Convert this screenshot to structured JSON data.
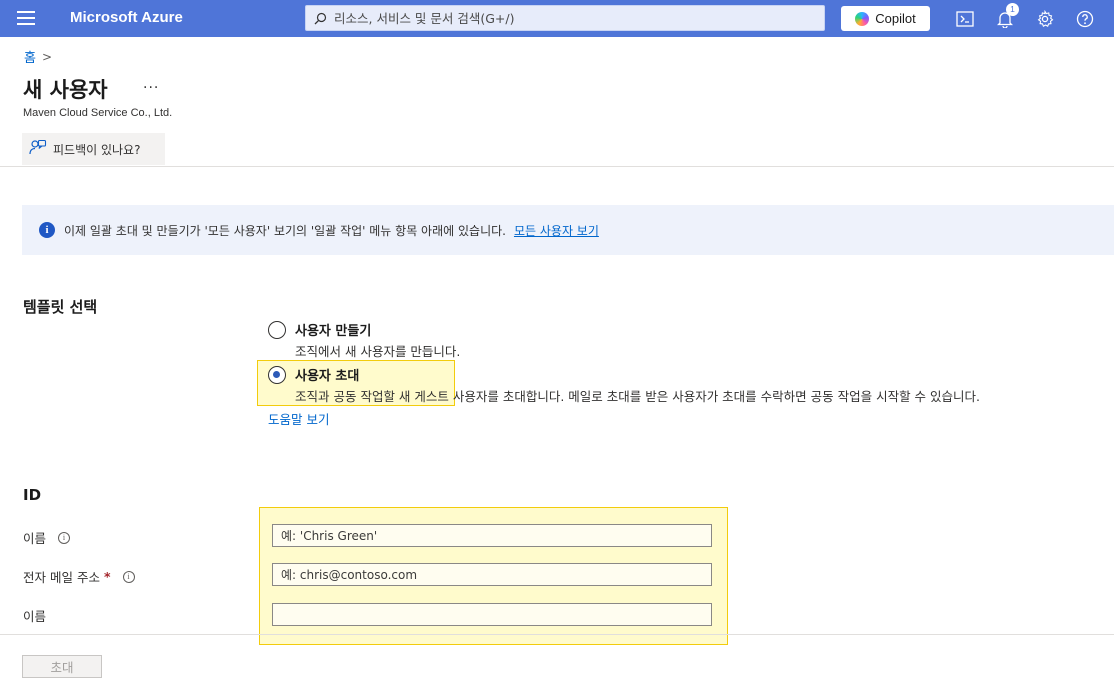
{
  "topbar": {
    "brand": "Microsoft Azure",
    "search_placeholder": "리소스, 서비스 및 문서 검색(G+/)",
    "copilot_label": "Copilot",
    "notification_count": "1",
    "icons": [
      "menu-icon",
      "search-icon",
      "copilot-icon",
      "cloud-shell-icon",
      "bell-icon",
      "gear-icon",
      "help-icon"
    ]
  },
  "breadcrumb": {
    "home": "홈",
    "separator": ">"
  },
  "page": {
    "title": "새 사용자",
    "more": "···",
    "subtitle": "Maven Cloud Service Co., Ltd.",
    "feedback": "피드백이 있나요?"
  },
  "info_banner": {
    "text": "이제 일괄 초대 및 만들기가 '모든 사용자' 보기의 '일괄 작업' 메뉴 항목 아래에 있습니다.",
    "link": "모든 사용자 보기"
  },
  "template": {
    "title": "템플릿 선택",
    "options": [
      {
        "label": "사용자 만들기",
        "desc": "조직에서 새 사용자를 만듭니다.",
        "selected": false
      },
      {
        "label": "사용자 초대",
        "desc": "조직과 공동 작업할 새 게스트 사용자를 초대합니다. 메일로 초대를 받은 사용자가 초대를 수락하면 공동 작업을 시작할 수 있습니다.",
        "selected": true
      }
    ],
    "help_link": "도움말 보기"
  },
  "identity": {
    "title": "ID",
    "fields": [
      {
        "label": "이름",
        "required": false,
        "info": true,
        "placeholder": "예: 'Chris Green'",
        "value": ""
      },
      {
        "label": "전자 메일 주소",
        "required": true,
        "info": true,
        "placeholder": "예: chris@contoso.com",
        "value": ""
      },
      {
        "label": "이름",
        "required": false,
        "info": false,
        "placeholder": "",
        "value": ""
      }
    ],
    "required_mark": "*"
  },
  "footer": {
    "submit_label": "초대"
  },
  "colors": {
    "topbar": "#4f75d8",
    "link": "#0066cc",
    "highlight_fill": "#fffbcc",
    "highlight_border": "#f2cc0c"
  }
}
